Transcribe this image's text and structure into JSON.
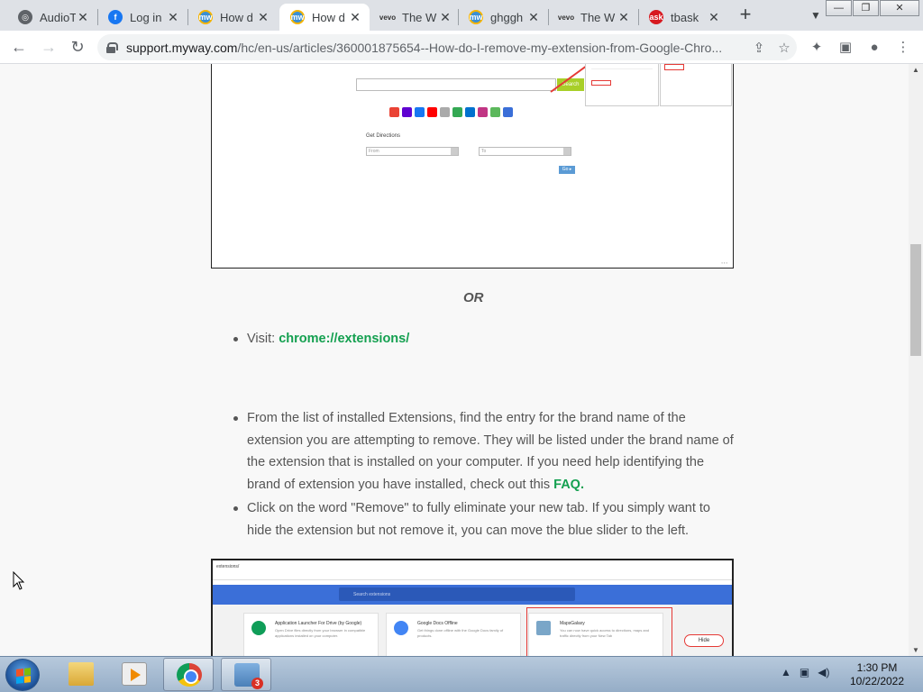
{
  "browser": {
    "tabs": [
      {
        "title": "AudioT",
        "favicon": "globe-icon",
        "color": "#5f6368"
      },
      {
        "title": "Log in",
        "favicon": "facebook-icon",
        "color": "#1877f2"
      },
      {
        "title": "How d",
        "favicon": "myway-icon",
        "color": "#3a8fd4"
      },
      {
        "title": "How d",
        "favicon": "myway-icon",
        "color": "#3a8fd4",
        "active": true
      },
      {
        "title": "The W",
        "favicon": "vevo-icon",
        "color": "#333333"
      },
      {
        "title": "ghggh",
        "favicon": "myway-icon",
        "color": "#3a8fd4"
      },
      {
        "title": "The W",
        "favicon": "vevo-icon",
        "color": "#333333"
      },
      {
        "title": "tbask",
        "favicon": "ask-icon",
        "color": "#d71920"
      }
    ],
    "url_host": "support.myway.com",
    "url_path": "/hc/en-us/articles/360001875654--How-do-I-remove-my-extension-from-Google-Chro..."
  },
  "article": {
    "screenshot1": {
      "search_button": "Search",
      "get_directions": "Get Directions",
      "from_placeholder": "From",
      "to_placeholder": "To",
      "go_button": "Go ▸"
    },
    "or_text": "OR",
    "visit_prefix": "Visit: ",
    "visit_link": "chrome://extensions/",
    "bullet2_text": "From the list of installed Extensions, find the entry for the brand name of the extension you are attempting to remove.  They will be listed under the brand name of the extension that is installed on your computer.  If you need help identifying the brand of extension you have installed, check out this ",
    "bullet2_link": "FAQ.",
    "bullet3_text": "Click on the word \"Remove\" to fully eliminate your new tab.  If you simply want to hide the extension but not remove it, you can move the blue slider to the left.",
    "screenshot2": {
      "address": "extensions/",
      "search_placeholder": "Search extensions",
      "cards": [
        {
          "title": "Application Launcher For Drive (by Google)",
          "desc": "Open Drive files directly from your browser in compatible applications installed on your computer.",
          "color": "#0f9d58"
        },
        {
          "title": "Google Docs Offline",
          "desc": "Get things done offline with the Google Docs family of products.",
          "color": "#4285f4"
        },
        {
          "title": "MapsGalaxy",
          "desc": "You can now have quick access to directions, maps and traffic directly from your New Tab",
          "color": "#7aa6c8"
        }
      ],
      "hide_label": "Hide"
    }
  },
  "taskbar": {
    "badge_count": "3",
    "time": "1:30 PM",
    "date": "10/22/2022"
  },
  "colors": {
    "link_green": "#14a050",
    "accent_blue": "#3b6fd8",
    "highlight_red": "#e53935"
  }
}
